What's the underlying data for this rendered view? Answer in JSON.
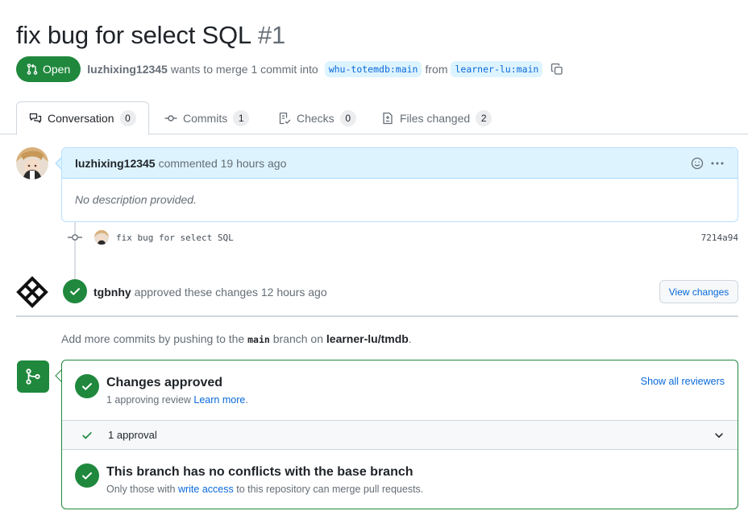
{
  "pr": {
    "title": "fix bug for select SQL",
    "number": "#1",
    "state": "Open",
    "author": "luzhixing12345",
    "merge_text": "wants to merge 1 commit into",
    "base_branch": "whu-totemdb:main",
    "from_text": "from",
    "head_branch": "learner-lu:main"
  },
  "tabs": [
    {
      "label": "Conversation",
      "count": "0"
    },
    {
      "label": "Commits",
      "count": "1"
    },
    {
      "label": "Checks",
      "count": "0"
    },
    {
      "label": "Files changed",
      "count": "2"
    }
  ],
  "comment": {
    "author": "luzhixing12345",
    "action": "commented 19 hours ago",
    "body": "No description provided."
  },
  "commit": {
    "message": "fix bug for select SQL",
    "sha": "7214a94"
  },
  "review": {
    "author": "tgbnhy",
    "text": "approved these changes 12 hours ago",
    "button": "View changes"
  },
  "push_hint": {
    "prefix": "Add more commits by pushing to the",
    "branch": "main",
    "middle": "branch on",
    "repo": "learner-lu/tmdb",
    "suffix": "."
  },
  "merge_box": {
    "approved_title": "Changes approved",
    "approved_sub": "1 approving review",
    "learn_more": "Learn more",
    "approved_sub_end": ".",
    "show_reviewers": "Show all reviewers",
    "approval_count": "1 approval",
    "conflicts_title": "This branch has no conflicts with the base branch",
    "conflicts_sub_prefix": "Only those with",
    "write_access": "write access",
    "conflicts_sub_suffix": "to this repository can merge pull requests."
  },
  "colors": {
    "success": "#1f883d",
    "link": "#0969da",
    "comment_header": "#ddf4ff"
  }
}
